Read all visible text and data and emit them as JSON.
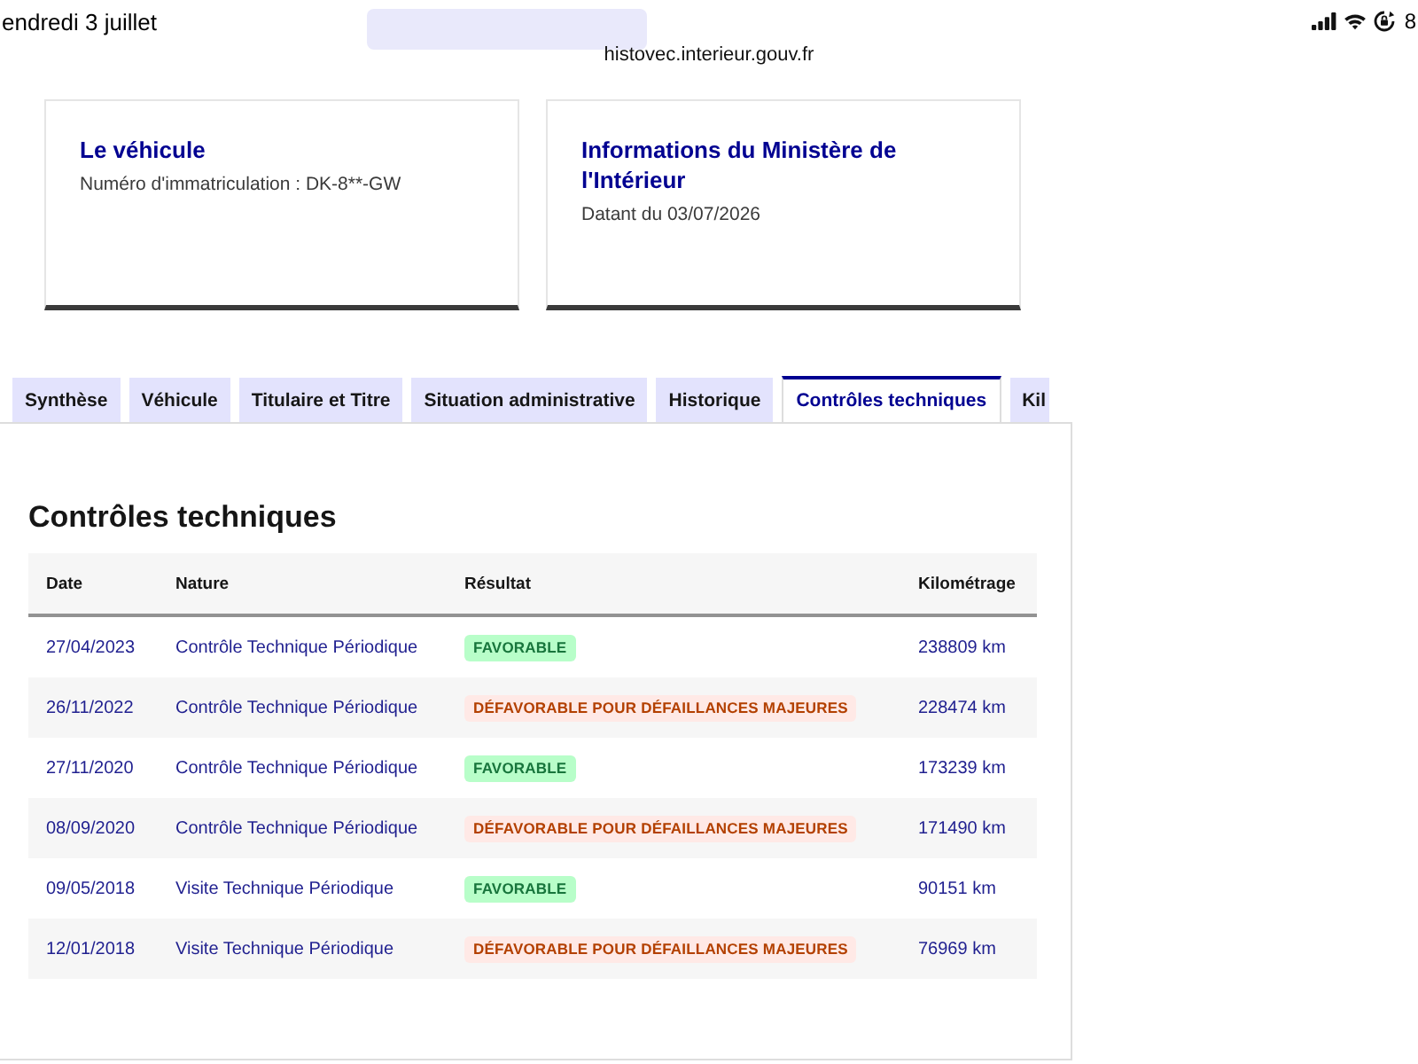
{
  "status_bar": {
    "date": "endredi 3 juillet",
    "battery": "8"
  },
  "address_bar": {
    "url": "histovec.interieur.gouv.fr"
  },
  "cards": [
    {
      "title": "Le véhicule",
      "detail": "Numéro d'immatriculation : DK-8**-GW"
    },
    {
      "title": "Informations du Ministère de l'Intérieur",
      "detail": "Datant du 03/07/2026"
    }
  ],
  "tabs": [
    {
      "label": "Synthèse",
      "selected": false
    },
    {
      "label": "Véhicule",
      "selected": false
    },
    {
      "label": "Titulaire et Titre",
      "selected": false
    },
    {
      "label": "Situation administrative",
      "selected": false
    },
    {
      "label": "Historique",
      "selected": false
    },
    {
      "label": "Contrôles techniques",
      "selected": true
    },
    {
      "label": "Kil",
      "selected": false
    }
  ],
  "section": {
    "title": "Contrôles techniques",
    "table": {
      "columns": [
        "Date",
        "Nature",
        "Résultat",
        "Kilométrage"
      ],
      "rows": [
        {
          "date": "27/04/2023",
          "nature": "Contrôle Technique Périodique",
          "result": {
            "label": "FAVORABLE",
            "kind": "success"
          },
          "mileage": "238809 km"
        },
        {
          "date": "26/11/2022",
          "nature": "Contrôle Technique Périodique",
          "result": {
            "label": "DÉFAVORABLE POUR DÉFAILLANCES MAJEURES",
            "kind": "error"
          },
          "mileage": "228474 km"
        },
        {
          "date": "27/11/2020",
          "nature": "Contrôle Technique Périodique",
          "result": {
            "label": "FAVORABLE",
            "kind": "success"
          },
          "mileage": "173239 km"
        },
        {
          "date": "08/09/2020",
          "nature": "Contrôle Technique Périodique",
          "result": {
            "label": "DÉFAVORABLE POUR DÉFAILLANCES MAJEURES",
            "kind": "error"
          },
          "mileage": "171490 km"
        },
        {
          "date": "09/05/2018",
          "nature": "Visite Technique Périodique",
          "result": {
            "label": "FAVORABLE",
            "kind": "success"
          },
          "mileage": "90151 km"
        },
        {
          "date": "12/01/2018",
          "nature": "Visite Technique Périodique",
          "result": {
            "label": "DÉFAVORABLE POUR DÉFAILLANCES MAJEURES",
            "kind": "error"
          },
          "mileage": "76969 km"
        }
      ]
    }
  }
}
